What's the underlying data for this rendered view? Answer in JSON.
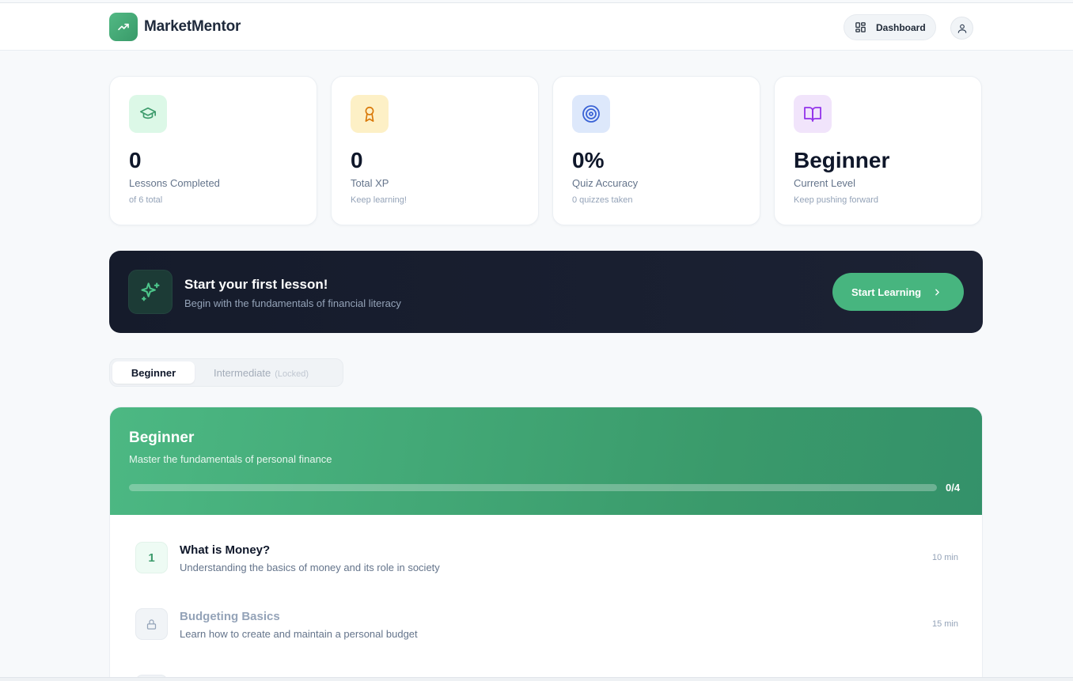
{
  "header": {
    "app_name": "MarketMentor",
    "dashboard_label": "Dashboard"
  },
  "stats": [
    {
      "value": "0",
      "label": "Lessons Completed",
      "sub": "of 6 total",
      "icon": "graduation-cap-icon",
      "icon_bg": "#dcf8e7",
      "icon_color": "#3d9b6c"
    },
    {
      "value": "0",
      "label": "Total XP",
      "sub": "Keep learning!",
      "icon": "award-icon",
      "icon_bg": "#fdf0c6",
      "icon_color": "#d97706"
    },
    {
      "value": "0%",
      "label": "Quiz Accuracy",
      "sub": "0 quizzes taken",
      "icon": "target-icon",
      "icon_bg": "#dde8fb",
      "icon_color": "#3b63d6"
    },
    {
      "value": "Beginner",
      "label": "Current Level",
      "sub": "Keep pushing forward",
      "icon": "book-open-icon",
      "icon_bg": "#f1e4fb",
      "icon_color": "#9333ea"
    }
  ],
  "banner": {
    "title": "Start your first lesson!",
    "subtitle": "Begin with the fundamentals of financial literacy",
    "button_label": "Start Learning"
  },
  "tabs": {
    "active": "Beginner",
    "locked": "Intermediate",
    "locked_note": "(Locked)"
  },
  "level": {
    "title": "Beginner",
    "subtitle": "Master the fundamentals of personal finance",
    "progress_text": "0/4",
    "progress_fraction": 0
  },
  "lessons": [
    {
      "number": "1",
      "title": "What is Money?",
      "subtitle": "Understanding the basics of money and its role in society",
      "duration": "10 min",
      "locked": false
    },
    {
      "number": "",
      "title": "Budgeting Basics",
      "subtitle": "Learn how to create and maintain a personal budget",
      "duration": "15 min",
      "locked": true
    }
  ],
  "colors": {
    "accent": "#47b57f",
    "dark": "#151b2b"
  }
}
